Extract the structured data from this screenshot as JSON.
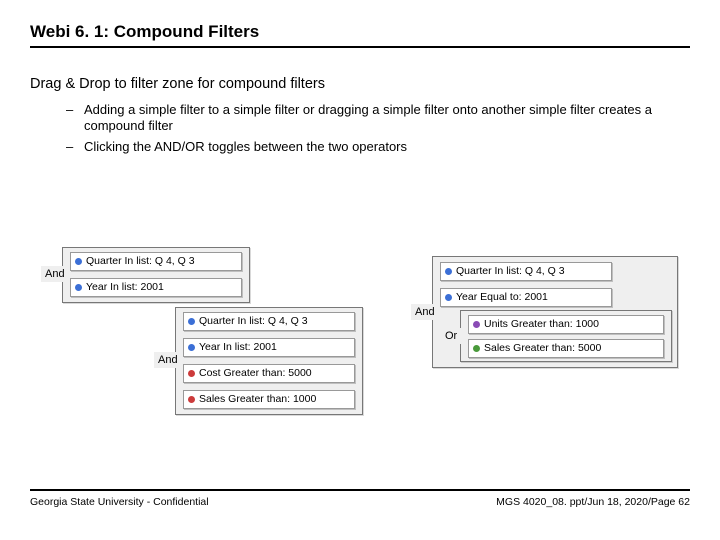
{
  "title": "Webi 6. 1: Compound Filters",
  "lead": "Drag & Drop to filter zone for compound filters",
  "bullets": [
    "Adding a simple filter to a simple filter or dragging a simple filter onto another simple filter creates a compound filter",
    "Clicking the AND/OR toggles between the two operators"
  ],
  "ops": {
    "and": "And",
    "or": "Or"
  },
  "chips": {
    "quarter": "Quarter In list: Q 4, Q 3",
    "year_in": "Year In list: 2001",
    "year_eq": "Year Equal to: 2001",
    "cost": "Cost Greater than: 5000",
    "sales": "Sales Greater than: 1000",
    "units": "Units Greater than: 1000",
    "sales2": "Sales Greater than: 5000"
  },
  "footer": {
    "left": "Georgia State University - Confidential",
    "right": "MGS 4020_08. ppt/Jun 18, 2020/Page 62"
  }
}
